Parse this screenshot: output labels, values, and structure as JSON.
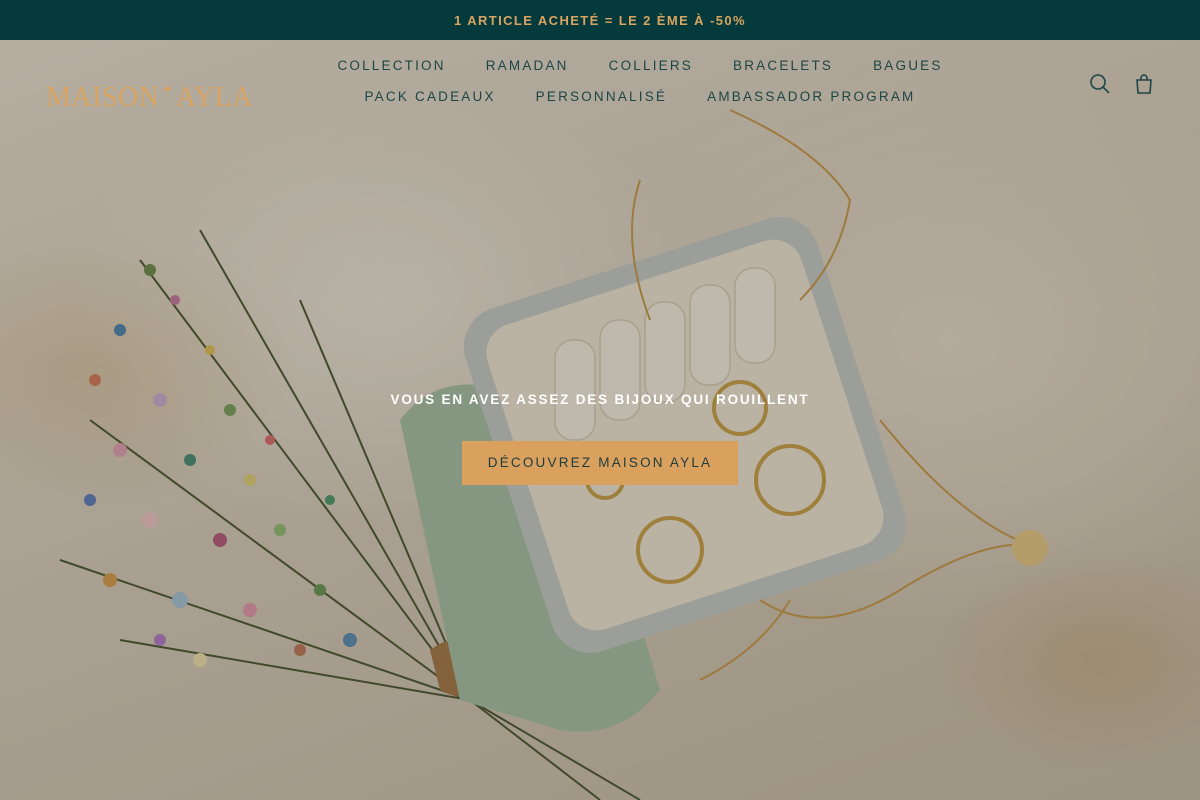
{
  "announcement": {
    "text": "1 ARTICLE ACHETÉ = LE 2 ÈME À -50%"
  },
  "header": {
    "logo": {
      "text": "MAISON AYLA"
    },
    "nav": [
      {
        "label": "COLLECTION"
      },
      {
        "label": "RAMADAN"
      },
      {
        "label": "COLLIERS"
      },
      {
        "label": "BRACELETS"
      },
      {
        "label": "BAGUES"
      },
      {
        "label": "PACK CADEAUX"
      },
      {
        "label": "PERSONNALISÉ"
      },
      {
        "label": "AMBASSADOR PROGRAM"
      }
    ],
    "icons": {
      "search": "search-icon",
      "cart": "shopping-bag-icon"
    }
  },
  "hero": {
    "heading": "VOUS EN AVEZ ASSEZ DES BIJOUX QUI ROUILLENT",
    "cta": "DÉCOUVREZ MAISON AYLA"
  },
  "colors": {
    "announcement_bg": "#043a3b",
    "accent_gold": "#d9a461",
    "nav_text": "#1e4546",
    "cta_bg": "#d9a05e"
  }
}
